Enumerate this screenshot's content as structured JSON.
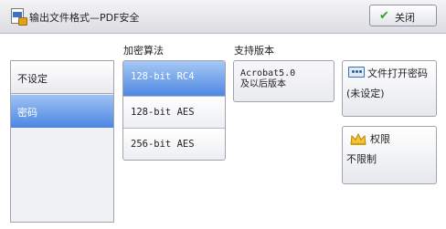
{
  "header": {
    "title": "输出文件格式—PDF安全",
    "close_label": "关闭"
  },
  "left_options": [
    {
      "label": "不设定",
      "selected": false
    },
    {
      "label": "密码",
      "selected": true
    }
  ],
  "columns": {
    "algorithm_header": "加密算法",
    "version_header": "支持版本"
  },
  "algorithms": [
    {
      "label": "128-bit RC4",
      "selected": true
    },
    {
      "label": "128-bit AES",
      "selected": false
    },
    {
      "label": "256-bit AES",
      "selected": false
    }
  ],
  "version_text": "Acrobat5.0\n及以后版本",
  "open_password": {
    "label": "文件打开密码",
    "value": "(未设定)",
    "icon": "password-icon"
  },
  "permissions": {
    "label": "权限",
    "value": "不限制",
    "icon": "crown-icon"
  },
  "colors": {
    "selected": "#4c86e2",
    "header_bg": "#dcdde2"
  }
}
